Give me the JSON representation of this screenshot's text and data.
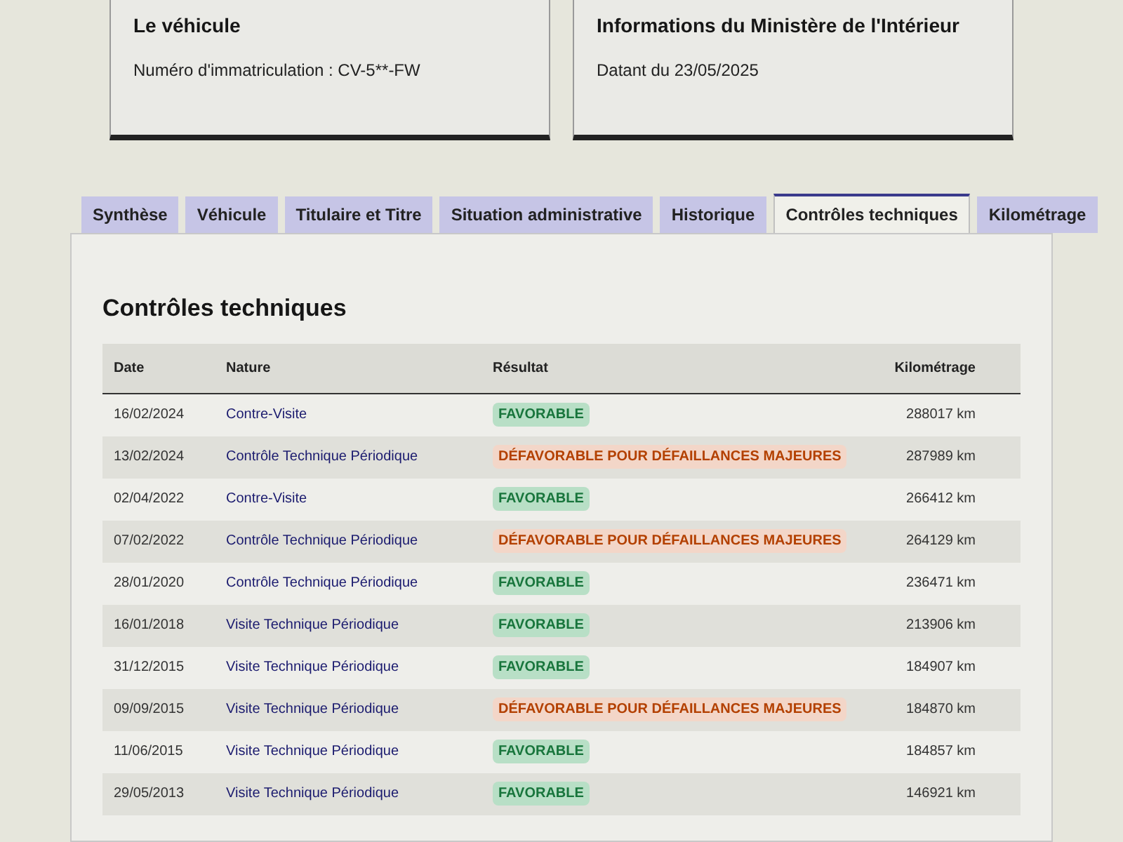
{
  "cards": [
    {
      "title": "Le véhicule",
      "text": "Numéro d'immatriculation : CV-5**-FW"
    },
    {
      "title": "Informations du Ministère de l'Intérieur",
      "text": "Datant du 23/05/2025"
    }
  ],
  "tabs": [
    {
      "label": "Synthèse",
      "selected": false
    },
    {
      "label": "Véhicule",
      "selected": false
    },
    {
      "label": "Titulaire et Titre",
      "selected": false
    },
    {
      "label": "Situation administrative",
      "selected": false
    },
    {
      "label": "Historique",
      "selected": false
    },
    {
      "label": "Contrôles techniques",
      "selected": true
    },
    {
      "label": "Kilométrage",
      "selected": false
    }
  ],
  "section_title": "Contrôles techniques",
  "table": {
    "columns": [
      "Date",
      "Nature",
      "Résultat",
      "Kilométrage"
    ],
    "rows": [
      {
        "date": "16/02/2024",
        "nature": "Contre-Visite",
        "result": {
          "kind": "favorable",
          "label": "FAVORABLE"
        },
        "km": "288017 km"
      },
      {
        "date": "13/02/2024",
        "nature": "Contrôle Technique Périodique",
        "result": {
          "kind": "defavorable",
          "label": "DÉFAVORABLE POUR DÉFAILLANCES MAJEURES"
        },
        "km": "287989 km"
      },
      {
        "date": "02/04/2022",
        "nature": "Contre-Visite",
        "result": {
          "kind": "favorable",
          "label": "FAVORABLE"
        },
        "km": "266412 km"
      },
      {
        "date": "07/02/2022",
        "nature": "Contrôle Technique Périodique",
        "result": {
          "kind": "defavorable",
          "label": "DÉFAVORABLE POUR DÉFAILLANCES MAJEURES"
        },
        "km": "264129 km"
      },
      {
        "date": "28/01/2020",
        "nature": "Contrôle Technique Périodique",
        "result": {
          "kind": "favorable",
          "label": "FAVORABLE"
        },
        "km": "236471 km"
      },
      {
        "date": "16/01/2018",
        "nature": "Visite Technique Périodique",
        "result": {
          "kind": "favorable",
          "label": "FAVORABLE"
        },
        "km": "213906 km"
      },
      {
        "date": "31/12/2015",
        "nature": "Visite Technique Périodique",
        "result": {
          "kind": "favorable",
          "label": "FAVORABLE"
        },
        "km": "184907 km"
      },
      {
        "date": "09/09/2015",
        "nature": "Visite Technique Périodique",
        "result": {
          "kind": "defavorable",
          "label": "DÉFAVORABLE POUR DÉFAILLANCES MAJEURES"
        },
        "km": "184870 km"
      },
      {
        "date": "11/06/2015",
        "nature": "Visite Technique Périodique",
        "result": {
          "kind": "favorable",
          "label": "FAVORABLE"
        },
        "km": "184857 km"
      },
      {
        "date": "29/05/2013",
        "nature": "Visite Technique Périodique",
        "result": {
          "kind": "favorable",
          "label": "FAVORABLE"
        },
        "km": "146921 km"
      }
    ]
  }
}
